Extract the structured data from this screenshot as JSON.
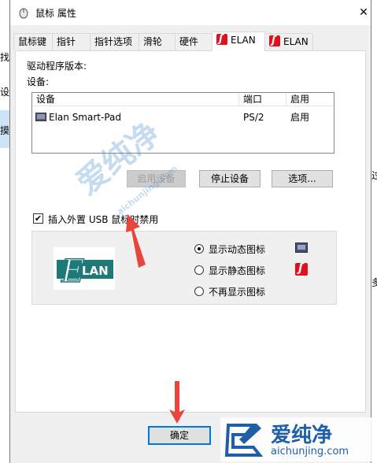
{
  "background": {
    "left_fragments": [
      "找",
      "设",
      "摸"
    ],
    "right_fragments": [
      "过",
      "多"
    ]
  },
  "window": {
    "title": "鼠标 属性",
    "close_glyph": "✕"
  },
  "tabs": [
    {
      "label": "鼠标键",
      "active": false
    },
    {
      "label": "指针",
      "active": false
    },
    {
      "label": "指针选项",
      "active": false
    },
    {
      "label": "滑轮",
      "active": false
    },
    {
      "label": "硬件",
      "active": false
    },
    {
      "label": "ELAN",
      "active": true,
      "icon": "elan-icon"
    },
    {
      "label": "ELAN",
      "active": false,
      "icon": "elan-icon"
    }
  ],
  "panel": {
    "driver_version_label": "驱动程序版本:",
    "devices_label": "设备:",
    "device_table": {
      "columns": [
        "设备",
        "端口",
        "启用"
      ],
      "rows": [
        {
          "device": "Elan Smart-Pad",
          "port": "PS/2",
          "enabled": "启用",
          "icon": "touchpad-icon"
        }
      ]
    },
    "buttons": {
      "enable_device": "启用设备",
      "disable_device": "停止设备",
      "options": "选项..."
    },
    "usb_checkbox": {
      "label": "插入外置 USB 鼠标时禁用",
      "checked": true,
      "check_glyph": "✔"
    },
    "tray_icon_group": {
      "logo_text": "LAN",
      "logo_letter": "E",
      "options": [
        {
          "label": "显示动态图标",
          "selected": true,
          "icon": "screen-icon"
        },
        {
          "label": "显示静态图标",
          "selected": false,
          "icon": "elan-icon"
        },
        {
          "label": "不再显示图标",
          "selected": false
        }
      ]
    }
  },
  "footer": {
    "ok_button": "确定"
  },
  "watermark": {
    "brand_text": "爱纯净",
    "url_text": "aichunjing.com"
  },
  "colors": {
    "annotation_arrow": "#e8453c",
    "elan_red": "#e0101c",
    "elan_teal": "#1f7a77",
    "focus_blue": "#0078d7"
  }
}
